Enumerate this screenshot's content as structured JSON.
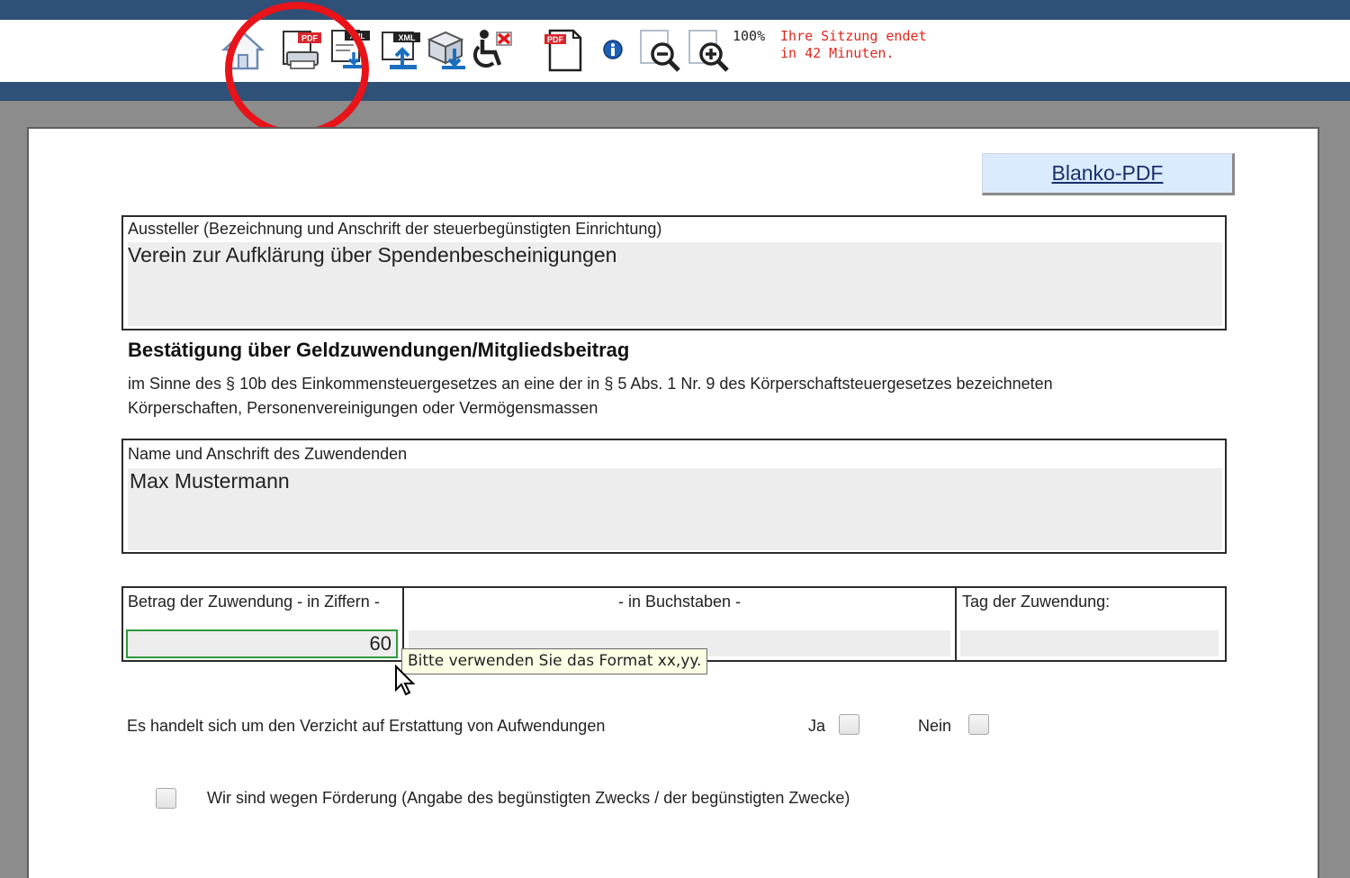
{
  "toolbar": {
    "icons": [
      "home-icon",
      "print-pdf-icon",
      "xml-export-icon",
      "xml-upload-icon",
      "package-download-icon",
      "accessibility-off-icon",
      "pdf-document-icon",
      "info-icon",
      "zoom-out-icon",
      "zoom-in-icon"
    ],
    "zoom": "100%",
    "session_line1": "Ihre Sitzung endet",
    "session_line2": "in 42 Minuten.",
    "pdf_badge": "PDF",
    "xml_badge": "XML"
  },
  "form": {
    "blanko_button": "Blanko-PDF",
    "aussteller_label": "Aussteller (Bezeichnung und Anschrift der steuerbegünstigten Einrichtung)",
    "aussteller_value": "Verein zur Aufklärung über Spendenbescheinigungen",
    "heading": "Bestätigung über Geldzuwendungen/Mitgliedsbeitrag",
    "paragraph": "im Sinne des § 10b des Einkommensteuergesetzes an eine der in § 5 Abs. 1 Nr. 9 des Körperschaftsteuergesetzes bezeichneten Körperschaften, Personenvereinigungen oder Vermögensmassen",
    "zuwendender_label": "Name und Anschrift des Zuwendenden",
    "zuwendender_value": "Max Mustermann",
    "betrag_label": "Betrag der Zuwendung - in Ziffern -",
    "betrag_value": "60",
    "buchstaben_label": "- in Buchstaben -",
    "tag_label": "Tag der Zuwendung:",
    "tooltip": "Bitte verwenden Sie das Format xx,yy.",
    "verzicht_label": "Es handelt sich um den Verzicht auf Erstattung von Aufwendungen",
    "ja_label": "Ja",
    "nein_label": "Nein",
    "foerderung_label": "Wir sind wegen Förderung (Angabe des begünstigten Zwecks / der begünstigten Zwecke)"
  },
  "colors": {
    "header_bar": "#2f5077",
    "highlight_circle": "#e8141a",
    "session_text": "#e0271d",
    "input_focus": "#2f9a3a"
  }
}
